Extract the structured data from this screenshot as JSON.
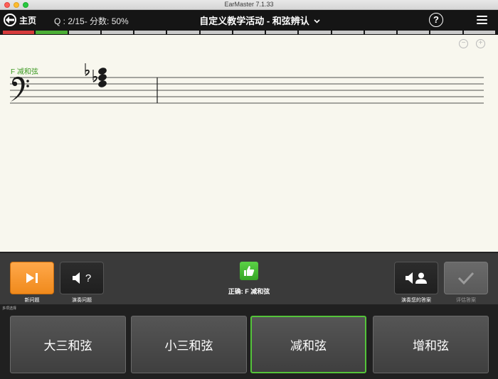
{
  "window": {
    "title": "EarMaster 7.1.33"
  },
  "header": {
    "home_label": "主页",
    "question_progress": "Q : 2/15- 分数: 50%",
    "title": "自定义教学活动 - 和弦辨认",
    "help_label": "?"
  },
  "progress_segments": {
    "count": 15,
    "states": [
      "incorrect",
      "correct",
      "pending",
      "pending",
      "pending",
      "pending",
      "pending",
      "pending",
      "pending",
      "pending",
      "pending",
      "pending",
      "pending",
      "pending",
      "pending"
    ],
    "colors": {
      "incorrect": "#d63b3b",
      "correct": "#4caf36",
      "pending": "#c9c9c9"
    }
  },
  "score": {
    "chord_label": "F 减和弦",
    "clef": "bass-clef-icon",
    "zoom_out": "−",
    "zoom_in": "+"
  },
  "controls": {
    "new_question_label": "新问题",
    "replay_question_label": "演奏问题",
    "replay_question_glyph": "?",
    "correct_text": "正确: F 减和弦",
    "play_answer_label": "演奏您的答案",
    "evaluate_label": "评估答案"
  },
  "answers": {
    "section_label": "多项选择",
    "options": [
      {
        "label": "大三和弦",
        "selected": false
      },
      {
        "label": "小三和弦",
        "selected": false
      },
      {
        "label": "减和弦",
        "selected": true
      },
      {
        "label": "增和弦",
        "selected": false
      }
    ]
  },
  "colors": {
    "accent_orange": "#f39a2e",
    "selected_green": "#54c43a",
    "chord_label_green": "#3c9a22"
  }
}
